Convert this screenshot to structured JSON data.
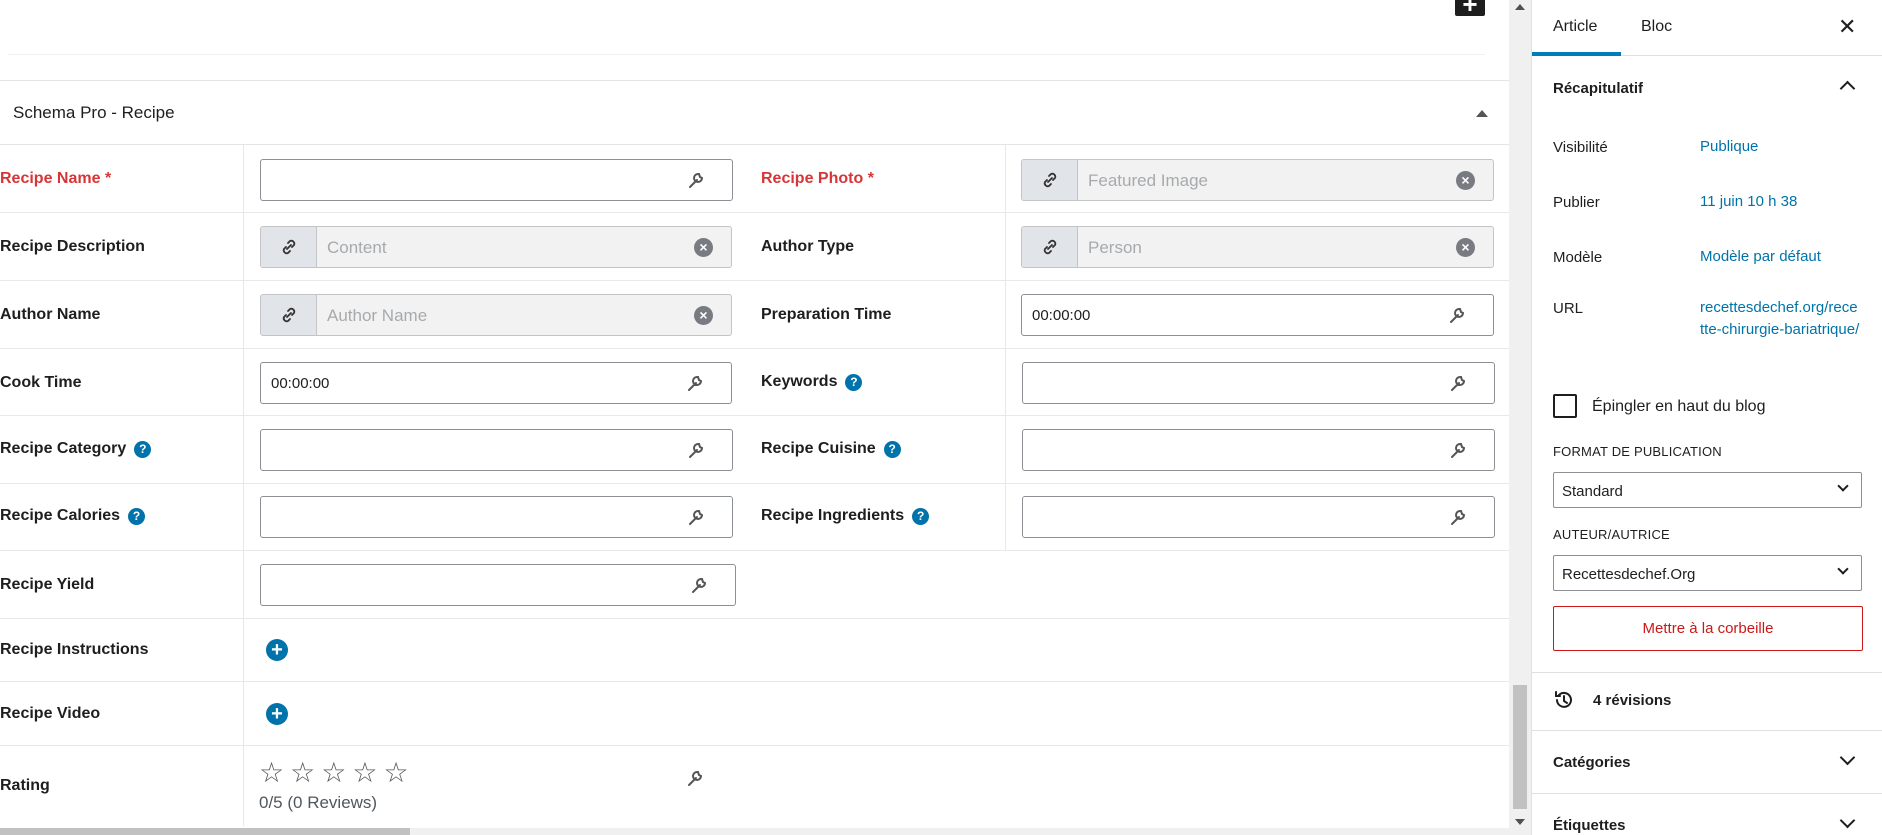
{
  "panel": {
    "title": "Schema Pro - Recipe"
  },
  "fields": {
    "recipe_name": {
      "label": "Recipe Name",
      "required": "*",
      "value": ""
    },
    "recipe_photo": {
      "label": "Recipe Photo",
      "required": "*",
      "placeholder": "Featured Image"
    },
    "recipe_description": {
      "label": "Recipe Description",
      "placeholder": "Content"
    },
    "author_type": {
      "label": "Author Type",
      "placeholder": "Person"
    },
    "author_name": {
      "label": "Author Name",
      "placeholder": "Author Name"
    },
    "preparation_time": {
      "label": "Preparation Time",
      "value": "00:00:00"
    },
    "cook_time": {
      "label": "Cook Time",
      "value": "00:00:00"
    },
    "keywords": {
      "label": "Keywords",
      "help": "?"
    },
    "recipe_category": {
      "label": "Recipe Category",
      "help": "?"
    },
    "recipe_cuisine": {
      "label": "Recipe Cuisine",
      "help": "?"
    },
    "recipe_calories": {
      "label": "Recipe Calories",
      "help": "?"
    },
    "recipe_ingredients": {
      "label": "Recipe Ingredients",
      "help": "?"
    },
    "recipe_yield": {
      "label": "Recipe Yield"
    },
    "recipe_instructions": {
      "label": "Recipe Instructions"
    },
    "recipe_video": {
      "label": "Recipe Video"
    },
    "rating": {
      "label": "Rating",
      "stars": 0,
      "max": 5,
      "text": "0/5 (0 Reviews)"
    }
  },
  "icons": {
    "link": "link-icon",
    "clear": "clear-icon",
    "wrench": "wrench-icon",
    "add": "add-circle-icon",
    "star": "star-outline-icon",
    "help": "help-icon",
    "chevron": "chevron-icon",
    "close": "close-icon",
    "history": "history-icon"
  },
  "sidebar": {
    "tabs": [
      "Article",
      "Bloc"
    ],
    "summary": {
      "title": "Récapitulatif",
      "visibility_label": "Visibilité",
      "visibility_value": "Publique",
      "publish_label": "Publier",
      "publish_value": "11 juin 10 h 38",
      "template_label": "Modèle",
      "template_value": "Modèle par défaut",
      "url_label": "URL",
      "url_value": "recettesdechef.org/recette-chirurgie-bariatrique/",
      "pin_label": "Épingler en haut du blog",
      "format_label": "FORMAT DE PUBLICATION",
      "format_value": "Standard",
      "author_label": "AUTEUR/AUTRICE",
      "author_value": "Recettesdechef.Org",
      "trash_label": "Mettre à la corbeille"
    },
    "revisions": "4 révisions",
    "categories": "Catégories",
    "tags": "Étiquettes"
  },
  "colors": {
    "accent": "#0073aa",
    "danger": "#d63638",
    "tab_active": "#007cba"
  }
}
